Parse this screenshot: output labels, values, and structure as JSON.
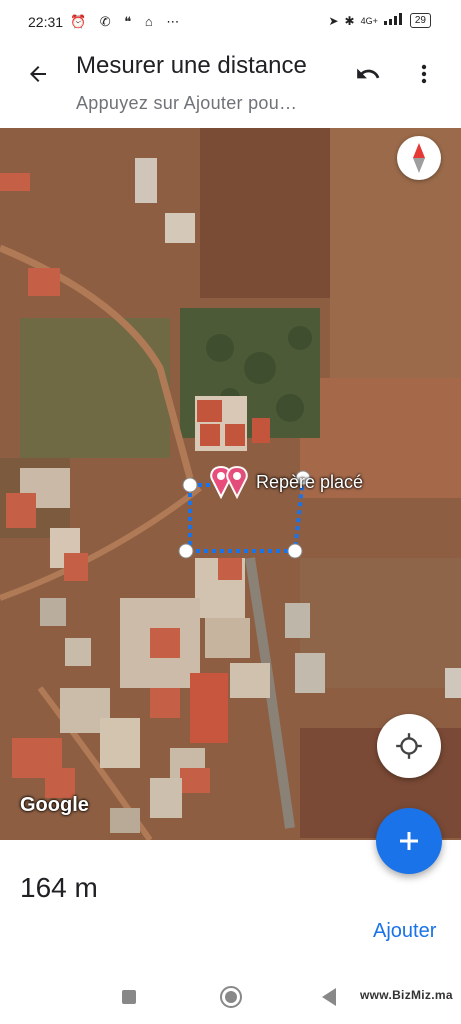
{
  "status_bar": {
    "time": "22:31",
    "left_icons": "⏰ ✆ ❝ ⌂ ⋯",
    "network": "4G+",
    "battery": "29"
  },
  "app_bar": {
    "title": "Mesurer une distance",
    "subtitle": "Appuyez sur Ajouter pou…",
    "icons": [
      "back-arrow-icon",
      "undo-icon",
      "more-vert-icon"
    ]
  },
  "map": {
    "attribution": "Google",
    "pin_label": "Repère placé",
    "accent_color": "#1a73e8"
  },
  "bottom_panel": {
    "distance": "164 m",
    "add_label": "Ajouter"
  },
  "watermark": "www.BizMiz.ma"
}
